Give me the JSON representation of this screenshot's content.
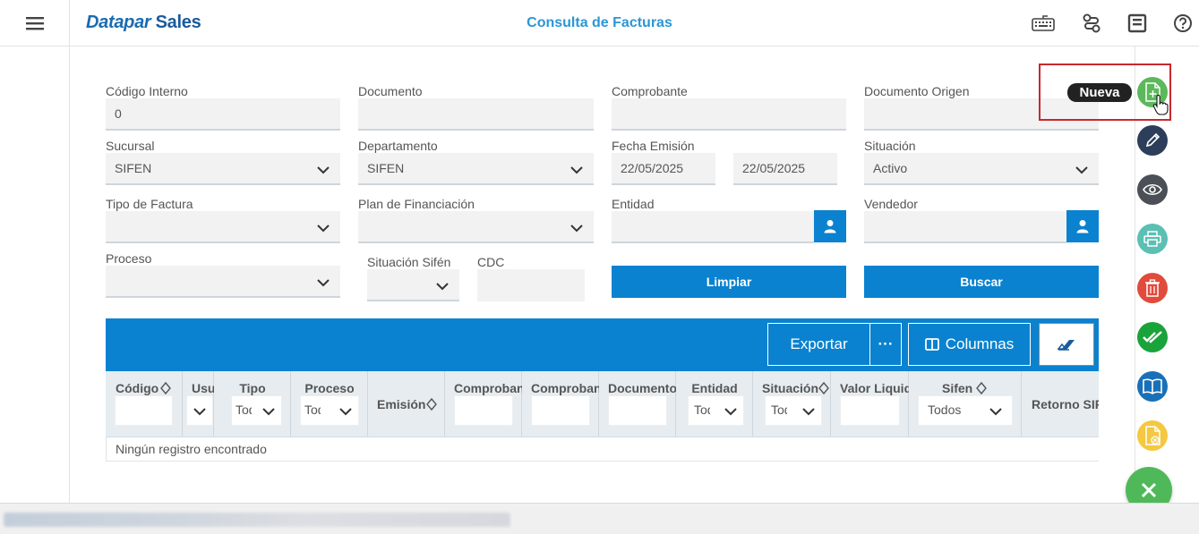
{
  "app": {
    "brand_part1": "Datapar",
    "brand_part2": "Sales",
    "page_title": "Consulta de Facturas",
    "top_icons": [
      "keyboard-icon",
      "route-icon",
      "form-icon",
      "help-icon"
    ]
  },
  "form": {
    "codigo_interno": {
      "label": "Código Interno",
      "value": "0"
    },
    "documento": {
      "label": "Documento",
      "value": ""
    },
    "comprobante": {
      "label": "Comprobante",
      "value": ""
    },
    "documento_origen": {
      "label": "Documento Origen",
      "value": ""
    },
    "sucursal": {
      "label": "Sucursal",
      "value": "SIFEN"
    },
    "departamento": {
      "label": "Departamento",
      "value": "SIFEN"
    },
    "fecha_emision": {
      "label": "Fecha Emisión",
      "from": "22/05/2025",
      "to": "22/05/2025"
    },
    "situacion": {
      "label": "Situación",
      "value": "Activo"
    },
    "tipo_factura": {
      "label": "Tipo de Factura",
      "value": ""
    },
    "plan_financiacion": {
      "label": "Plan de Financiación",
      "value": ""
    },
    "entidad": {
      "label": "Entidad",
      "value": ""
    },
    "vendedor": {
      "label": "Vendedor",
      "value": ""
    },
    "proceso": {
      "label": "Proceso",
      "value": ""
    },
    "situacion_sifen": {
      "label": "Situación Sifén",
      "value": ""
    },
    "cdc": {
      "label": "CDC",
      "value": ""
    },
    "limpiar_label": "Limpiar",
    "buscar_label": "Buscar"
  },
  "grid": {
    "toolbar": {
      "exportar_label": "Exportar",
      "more_label": "···",
      "columnas_label": "Columnas"
    },
    "columns": [
      {
        "title": "Código",
        "sortable": true,
        "filter": ""
      },
      {
        "title": "Usuario",
        "filter_select": ""
      },
      {
        "title": "Tipo",
        "filter_select": "Todos"
      },
      {
        "title": "Proceso",
        "filter_select": "Todos"
      },
      {
        "title": "Emisión",
        "sortable": true
      },
      {
        "title": "Comprobante",
        "filter": ""
      },
      {
        "title": "Comprobante",
        "filter": ""
      },
      {
        "title": "Documento",
        "filter": ""
      },
      {
        "title": "Entidad",
        "filter_select": "Todos"
      },
      {
        "title": "Situación",
        "sortable": true,
        "filter_select": "Todos"
      },
      {
        "title": "Valor Liquido",
        "filter": ""
      },
      {
        "title": "Sifen",
        "sortable": true,
        "filter_select": "Todos"
      },
      {
        "title": "Retorno SIFEN"
      }
    ],
    "empty_message": "Ningún registro encontrado"
  },
  "actions": {
    "tooltip": "Nueva",
    "items": [
      "new-document-icon",
      "edit-icon",
      "view-icon",
      "print-icon",
      "delete-icon",
      "approve-icon",
      "book-icon",
      "cancel-document-icon"
    ],
    "colors": {
      "new": "#5cb85c",
      "edit": "#2c3e5a",
      "view": "#4a5056",
      "print": "#5bbfb3",
      "delete": "#e04b3c",
      "approve": "#1aa33a",
      "book": "#1a70b8",
      "cancel": "#f5c842"
    }
  },
  "theme": {
    "primary": "#0a82cf",
    "title": "#2a96d6",
    "highlight": "#c8282e"
  }
}
